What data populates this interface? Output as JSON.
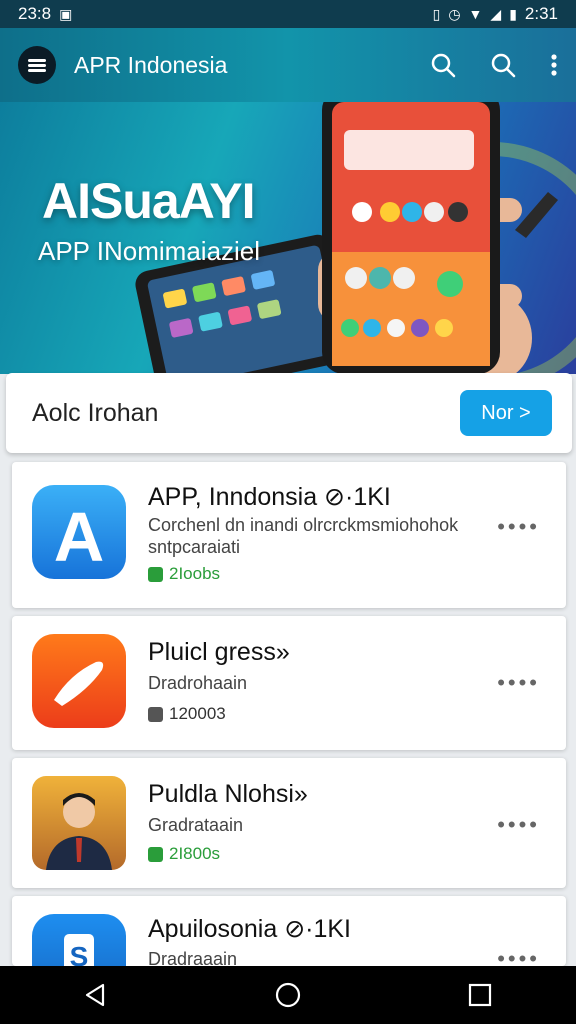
{
  "status_bar": {
    "time_left": "23:8",
    "time_right": "2:31"
  },
  "app_bar": {
    "title": "APR Indonesia"
  },
  "hero": {
    "title": "AISuaAYI",
    "subtitle": "APP INomimaiaziel"
  },
  "search": {
    "text": "Aolc Irohan",
    "button_label": "Nor >"
  },
  "apps": [
    {
      "name": "APP, Inndonsia ⊘·1KI",
      "desc": "Corchenl dn inandi olrcrckmsmiohohok sntpcaraiati",
      "meta": "2Ioobs",
      "meta_color": "#2a9d3a"
    },
    {
      "name": "Pluicl gress»",
      "desc": "Dradrohaain",
      "meta": "120003",
      "meta_color": "#333333"
    },
    {
      "name": "Puldla Nlohsi»",
      "desc": "Gradrataain",
      "meta": "2I800s",
      "meta_color": "#2a9d3a"
    },
    {
      "name": "Apuilosonia ⊘·1KI",
      "desc": "Dradraaain",
      "meta": "",
      "meta_color": "#333333"
    }
  ],
  "more_label": "••••",
  "colors": {
    "accent": "#15a1e6",
    "appbar": "#1294aa"
  }
}
